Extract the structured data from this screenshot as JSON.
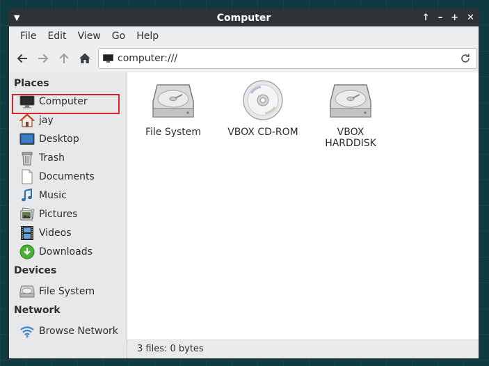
{
  "window": {
    "title": "Computer"
  },
  "menubar": {
    "items": [
      "File",
      "Edit",
      "View",
      "Go",
      "Help"
    ]
  },
  "toolbar": {
    "location": "computer:///"
  },
  "sidebar": {
    "places_header": "Places",
    "places": [
      {
        "label": "Computer",
        "icon": "computer-icon"
      },
      {
        "label": "jay",
        "icon": "home-icon"
      },
      {
        "label": "Desktop",
        "icon": "desktop-icon"
      },
      {
        "label": "Trash",
        "icon": "trash-icon"
      },
      {
        "label": "Documents",
        "icon": "document-icon"
      },
      {
        "label": "Music",
        "icon": "music-icon"
      },
      {
        "label": "Pictures",
        "icon": "pictures-icon"
      },
      {
        "label": "Videos",
        "icon": "videos-icon"
      },
      {
        "label": "Downloads",
        "icon": "downloads-icon"
      }
    ],
    "devices_header": "Devices",
    "devices": [
      {
        "label": "File System",
        "icon": "harddisk-icon"
      }
    ],
    "network_header": "Network",
    "network": [
      {
        "label": "Browse Network",
        "icon": "network-icon"
      }
    ]
  },
  "main": {
    "files": [
      {
        "label": "File System",
        "icon": "harddisk-icon"
      },
      {
        "label": "VBOX CD-ROM",
        "icon": "cdrom-icon"
      },
      {
        "label": "VBOX HARDDISK",
        "icon": "harddisk-icon"
      }
    ]
  },
  "status": {
    "text": "3 files: 0 bytes"
  },
  "colors": {
    "titlebar": "#2e3338",
    "selection_box": "#d7262b",
    "accent": "#3b86c8"
  }
}
